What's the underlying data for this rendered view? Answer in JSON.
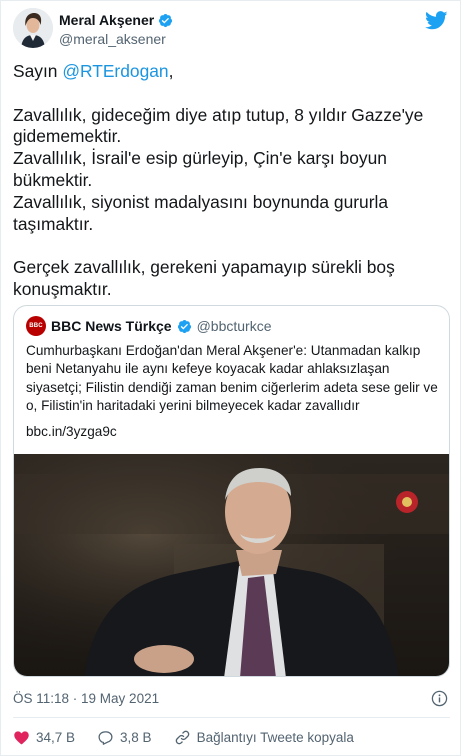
{
  "author": {
    "name": "Meral Akşener",
    "handle": "@meral_aksener"
  },
  "tweet": {
    "greeting": "Sayın ",
    "mention": "@RTErdogan",
    "greeting_end": ",",
    "line1": "Zavallılık, gideceğim diye atıp tutup, 8 yıldır Gazze'ye gidememektir.",
    "line2": "Zavallılık, İsrail'e esip gürleyip, Çin'e karşı boyun bükmektir.",
    "line3": "Zavallılık, siyonist madalyasını boynunda gururla taşımaktır.",
    "line4": "Gerçek zavallılık, gerekeni yapamayıp sürekli boş konuşmaktır."
  },
  "quote": {
    "avatar_text": "BBC",
    "name": "BBC News Türkçe",
    "handle": "@bbcturkce",
    "text": "Cumhurbaşkanı Erdoğan'dan Meral Akşener'e: Utanmadan kalkıp beni Netanyahu ile aynı kefeye koyacak kadar ahlaksızlaşan siyasetçi; Filistin dendiği zaman benim ciğerlerim adeta sese gelir ve o, Filistin'in haritadaki yerini bilmeyecek kadar zavallıdır",
    "link": "bbc.in/3yzga9c"
  },
  "meta": {
    "timestamp": "ÖS 11:18 · 19 May 2021"
  },
  "actions": {
    "likes": "34,7 B",
    "replies": "3,8 B",
    "copy_link": "Bağlantıyı Tweete kopyala"
  },
  "colors": {
    "accent": "#1da1f2",
    "link": "#1b95e0",
    "like": "#e0245e",
    "secondary_text": "#536471",
    "bbc_red": "#b80000"
  },
  "icons": [
    "verified-icon",
    "twitter-bird-icon",
    "info-icon",
    "heart-icon",
    "reply-icon",
    "link-icon"
  ]
}
